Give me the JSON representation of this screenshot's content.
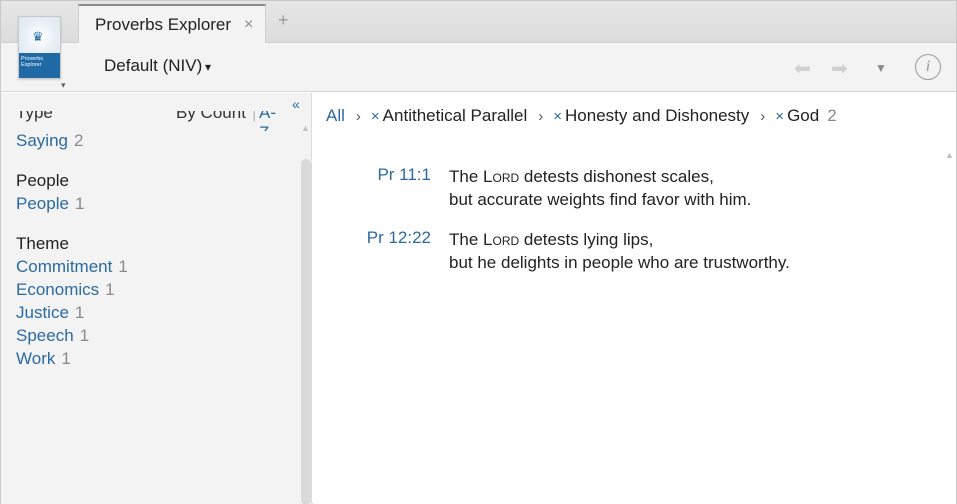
{
  "tab": {
    "title": "Proverbs Explorer",
    "close_icon": "×",
    "add_icon": "+"
  },
  "book": {
    "cover_label": "Proverbs Explorer",
    "dropdown_icon": "▾"
  },
  "version": {
    "label": "Default (NIV)",
    "caret": "▾"
  },
  "nav": {
    "back_icon": "⬅",
    "forward_icon": "➡",
    "menu_icon": "▼",
    "info_icon": "i"
  },
  "sidebar": {
    "collapse_icon": "«",
    "header": {
      "type_label": "Type",
      "by_count_label": "By Count",
      "sep": "|",
      "az_label": "A-Z"
    },
    "type_items": [
      {
        "label": "Saying",
        "count": "2"
      }
    ],
    "people": {
      "title": "People",
      "items": [
        {
          "label": "People",
          "count": "1"
        }
      ]
    },
    "theme": {
      "title": "Theme",
      "items": [
        {
          "label": "Commitment",
          "count": "1"
        },
        {
          "label": "Economics",
          "count": "1"
        },
        {
          "label": "Justice",
          "count": "1"
        },
        {
          "label": "Speech",
          "count": "1"
        },
        {
          "label": "Work",
          "count": "1"
        }
      ]
    }
  },
  "breadcrumb": {
    "all": "All",
    "arrow": "›",
    "remove_icon": "×",
    "filters": [
      {
        "label": "Antithetical Parallel"
      },
      {
        "label": "Honesty and Dishonesty"
      },
      {
        "label": "God",
        "count": "2"
      }
    ]
  },
  "verses": [
    {
      "ref": "Pr 11:1",
      "line1_pre": "The ",
      "line1_lord": "Lord",
      "line1_post": " detests dishonest scales,",
      "line2": "but accurate weights find favor with him."
    },
    {
      "ref": "Pr 12:22",
      "line1_pre": "The ",
      "line1_lord": "Lord",
      "line1_post": " detests lying lips,",
      "line2": "but he delights in people who are trustworthy."
    }
  ],
  "colors": {
    "link": "#2b6aa0",
    "cover_band": "#1f6aa5",
    "chrome": "#f3f3f3"
  }
}
